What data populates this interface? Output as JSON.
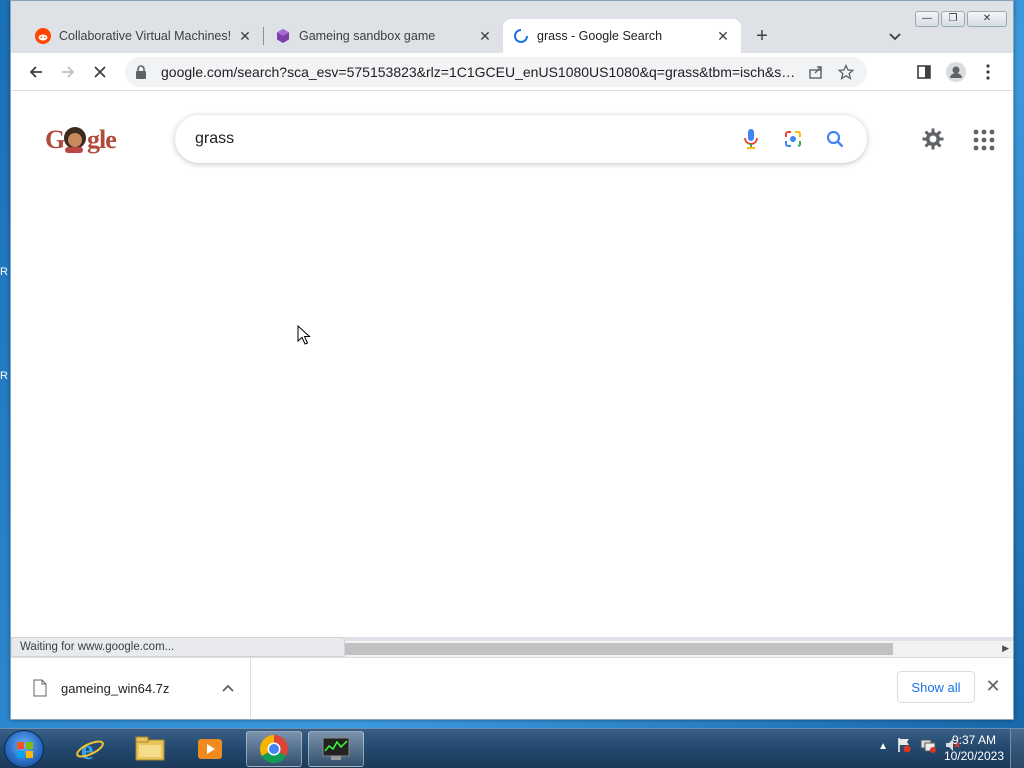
{
  "desktop": {
    "edge_glyphs": [
      "R",
      "R"
    ]
  },
  "window_controls": {
    "minimize": "—",
    "restore": "❐",
    "close": "✕"
  },
  "tabs": [
    {
      "title": "Collaborative Virtual Machines!",
      "favicon": "reddit-icon"
    },
    {
      "title": "Gameing sandbox game",
      "favicon": "itch-game-icon"
    },
    {
      "title": "grass - Google Search",
      "favicon": "loading-spinner-icon",
      "active": true
    }
  ],
  "tab_close_glyph": "✕",
  "new_tab_glyph": "+",
  "toolbar": {
    "url": "google.com/search?sca_esv=575153823&rlz=1C1GCEU_enUS1080US1080&q=grass&tbm=isch&source=ln..."
  },
  "page": {
    "logo_text": "Google",
    "search_query": "grass"
  },
  "status": {
    "text": "Waiting for www.google.com..."
  },
  "downloads": {
    "file_name": "gameing_win64.7z",
    "show_all_label": "Show all",
    "close_glyph": "✕"
  },
  "taskbar": {
    "apps": [
      "internet-explorer-icon",
      "file-explorer-icon",
      "media-player-icon",
      "chrome-icon",
      "network-monitor-icon"
    ],
    "clock_time": "9:37 AM",
    "clock_date": "10/20/2023"
  },
  "colors": {
    "accent_blue": "#1a73e8",
    "desktop_blue": "#2b87cf",
    "tab_strip": "#dee1e6"
  }
}
